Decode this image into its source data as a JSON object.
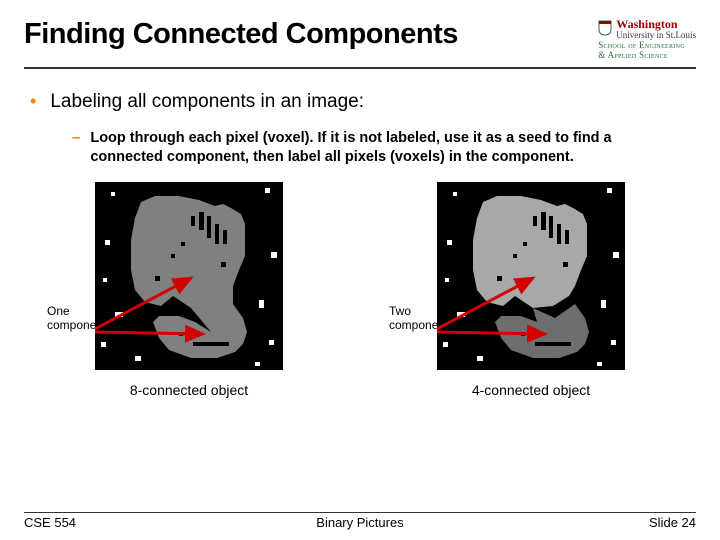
{
  "header": {
    "title": "Finding Connected Components"
  },
  "logo": {
    "uni_name": "Washington",
    "uni_sub": "University in St.Louis",
    "school_line1": "School of Engineering",
    "school_line2": "& Applied Science"
  },
  "content": {
    "bullet1": "Labeling all components in an image:",
    "bullet2": "Loop through each pixel (voxel). If it is not labeled, use it as a seed to find a connected component, then label all pixels (voxels) in the component."
  },
  "figures": {
    "left": {
      "label": "One component",
      "caption": "8-connected object"
    },
    "right": {
      "label": "Two components",
      "caption": "4-connected object"
    }
  },
  "footer": {
    "left": "CSE 554",
    "center": "Binary Pictures",
    "right": "Slide 24"
  }
}
